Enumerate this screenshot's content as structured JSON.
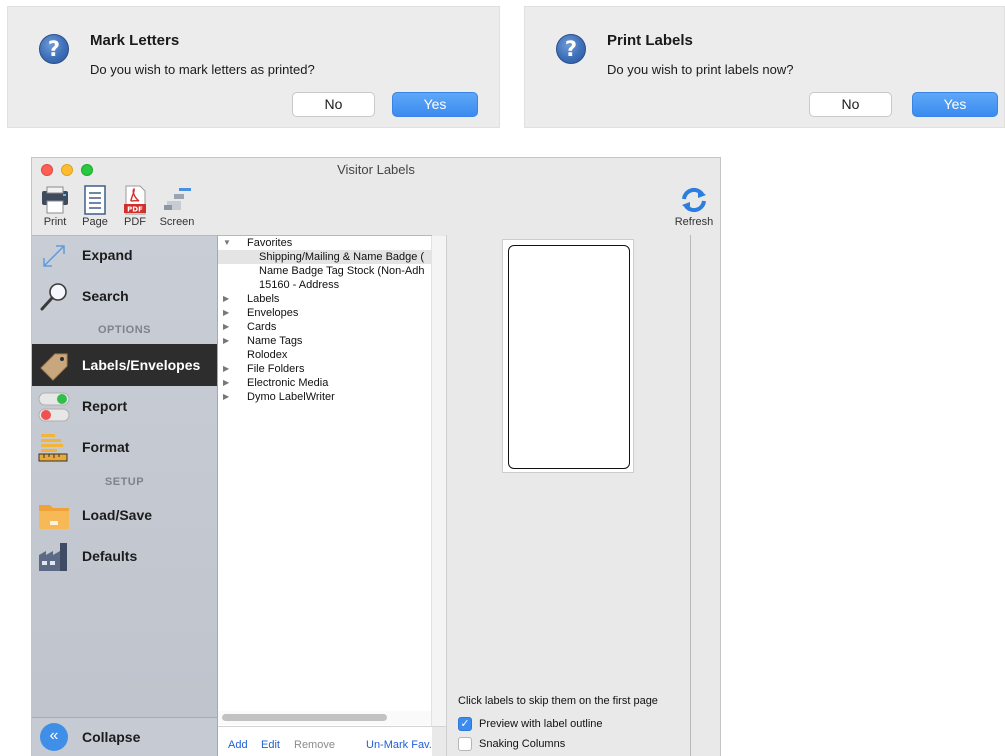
{
  "dialogs": [
    {
      "title": "Mark Letters",
      "message": "Do you wish to mark letters as printed?",
      "no_label": "No",
      "yes_label": "Yes"
    },
    {
      "title": "Print Labels",
      "message": "Do you wish to print labels now?",
      "no_label": "No",
      "yes_label": "Yes"
    }
  ],
  "window": {
    "title": "Visitor Labels",
    "toolbar": {
      "print": "Print",
      "page": "Page",
      "pdf": "PDF",
      "screen": "Screen",
      "refresh": "Refresh"
    },
    "sidebar": {
      "expand": "Expand",
      "search": "Search",
      "options_header": "OPTIONS",
      "labels_envelopes": "Labels/Envelopes",
      "report": "Report",
      "format": "Format",
      "setup_header": "SETUP",
      "load_save": "Load/Save",
      "defaults": "Defaults",
      "collapse": "Collapse",
      "active_item": "Labels/Envelopes"
    },
    "tree": {
      "items": [
        "Favorites",
        "Shipping/Mailing & Name Badge (",
        "Name Badge Tag Stock (Non-Adh",
        "15160 - Address",
        "Labels",
        "Envelopes",
        "Cards",
        "Name Tags",
        "Rolodex",
        "File Folders",
        "Electronic Media",
        "Dymo LabelWriter"
      ],
      "actions": {
        "add": "Add",
        "edit": "Edit",
        "remove": "Remove",
        "unmark_fav": "Un-Mark Fav."
      }
    },
    "preview": {
      "hint": "Click labels to skip them on the first page",
      "preview_outline_label": "Preview with label outline",
      "preview_outline_checked": true,
      "snaking_columns_label": "Snaking Columns",
      "snaking_columns_checked": false
    }
  },
  "colors": {
    "accent": "#3b8bf0",
    "sidebar_active": "#2d2d2d",
    "link": "#1f5fd6"
  }
}
